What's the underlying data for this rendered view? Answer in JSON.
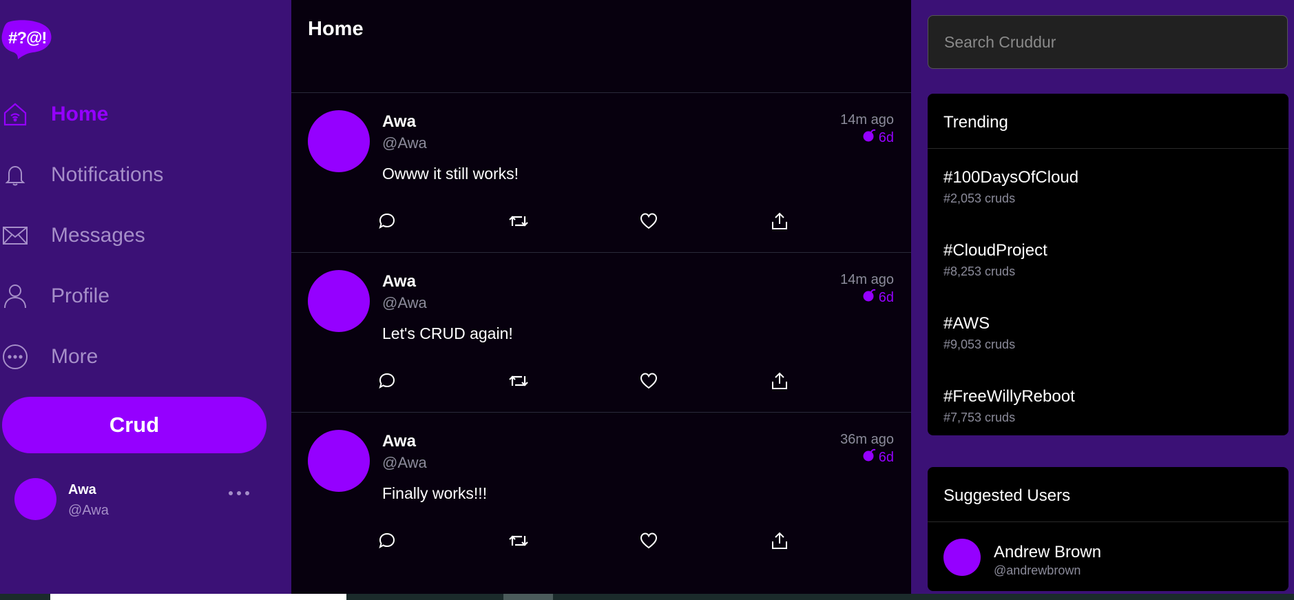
{
  "app": {
    "logo_text": "#?@!"
  },
  "sidebar": {
    "items": [
      {
        "label": "Home",
        "icon": "home-icon",
        "active": true
      },
      {
        "label": "Notifications",
        "icon": "bell-icon",
        "active": false
      },
      {
        "label": "Messages",
        "icon": "envelope-icon",
        "active": false
      },
      {
        "label": "Profile",
        "icon": "user-icon",
        "active": false
      },
      {
        "label": "More",
        "icon": "more-circle-icon",
        "active": false
      }
    ],
    "crud_button": "Crud",
    "current_user": {
      "name": "Awa",
      "handle": "@Awa"
    }
  },
  "feed": {
    "title": "Home",
    "posts": [
      {
        "name": "Awa",
        "handle": "@Awa",
        "message": "Owww it still works!",
        "ago": "14m ago",
        "expires": "6d"
      },
      {
        "name": "Awa",
        "handle": "@Awa",
        "message": "Let's CRUD again!",
        "ago": "14m ago",
        "expires": "6d"
      },
      {
        "name": "Awa",
        "handle": "@Awa",
        "message": "Finally works!!!",
        "ago": "36m ago",
        "expires": "6d"
      }
    ]
  },
  "search": {
    "placeholder": "Search Cruddur"
  },
  "trending": {
    "title": "Trending",
    "items": [
      {
        "tag": "#100DaysOfCloud",
        "count": "#2,053 cruds"
      },
      {
        "tag": "#CloudProject",
        "count": "#8,253 cruds"
      },
      {
        "tag": "#AWS",
        "count": "#9,053 cruds"
      },
      {
        "tag": "#FreeWillyReboot",
        "count": "#7,753 cruds"
      }
    ]
  },
  "suggested": {
    "title": "Suggested Users",
    "users": [
      {
        "name": "Andrew Brown",
        "handle": "@andrewbrown"
      }
    ]
  },
  "colors": {
    "accent": "#9500ff",
    "sidebar_bg": "#3b1176",
    "feed_bg": "#07000e"
  }
}
